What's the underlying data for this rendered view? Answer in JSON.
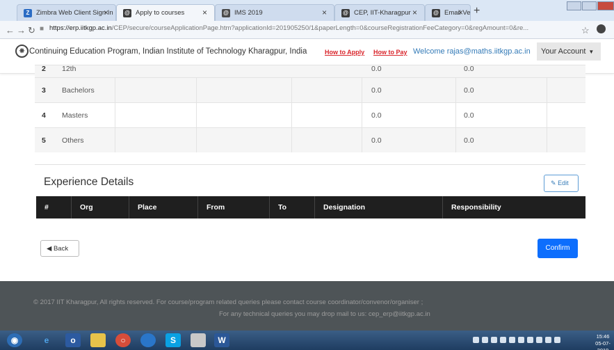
{
  "browser": {
    "tabs": [
      {
        "title": "Zimbra Web Client Sign In",
        "icon_letter": "Z",
        "icon_color": "#2b6cc4"
      },
      {
        "title": "Apply to courses",
        "icon_letter": "@",
        "icon_color": "#3a3a3a"
      },
      {
        "title": "IMS 2019",
        "icon_letter": "@",
        "icon_color": "#4a4a4a"
      },
      {
        "title": "CEP, IIT-Kharagpur",
        "icon_letter": "@",
        "icon_color": "#3a3a3a"
      },
      {
        "title": "Email Verification Link Sent",
        "icon_letter": "@",
        "icon_color": "#3a3a3a"
      }
    ],
    "url_domain": "https://erp.iitkgp.ac.in",
    "url_path": "/CEP/secure/courseApplicationPage.htm?applicationId=201905250/1&paperLength=0&courseRegistrationFeeCategory=0&regAmount=0&re..."
  },
  "site": {
    "title": "Continuing Education Program, Indian Institute of Technology Kharagpur, India",
    "how_to_apply": "How to Apply",
    "how_to_pay": "How to Pay",
    "welcome": "Welcome rajas@maths.iitkgp.ac.in",
    "account_label": "Your Account"
  },
  "education": {
    "rows": [
      {
        "num": "2",
        "degree": "12th",
        "v1": "0.0",
        "v2": "0.0"
      },
      {
        "num": "3",
        "degree": "Bachelors",
        "v1": "0.0",
        "v2": "0.0"
      },
      {
        "num": "4",
        "degree": "Masters",
        "v1": "0.0",
        "v2": "0.0"
      },
      {
        "num": "5",
        "degree": "Others",
        "v1": "0.0",
        "v2": "0.0"
      }
    ]
  },
  "experience": {
    "title": "Experience Details",
    "edit_label": "Edit",
    "columns": [
      "#",
      "Org",
      "Place",
      "From",
      "To",
      "Designation",
      "Responsibility"
    ]
  },
  "actions": {
    "back_label": "Back",
    "confirm_label": "Confirm"
  },
  "footer": {
    "line1": "© 2017 IIT Kharagpur, All rights reserved.  For course/program related queries please contact course coordinator/convenor/organiser ;",
    "line2": "For any technical queries you may drop mail to us: cep_erp@iitkgp.ac.in"
  },
  "taskbar": {
    "time": "15:46",
    "date": "05-07-2019"
  }
}
